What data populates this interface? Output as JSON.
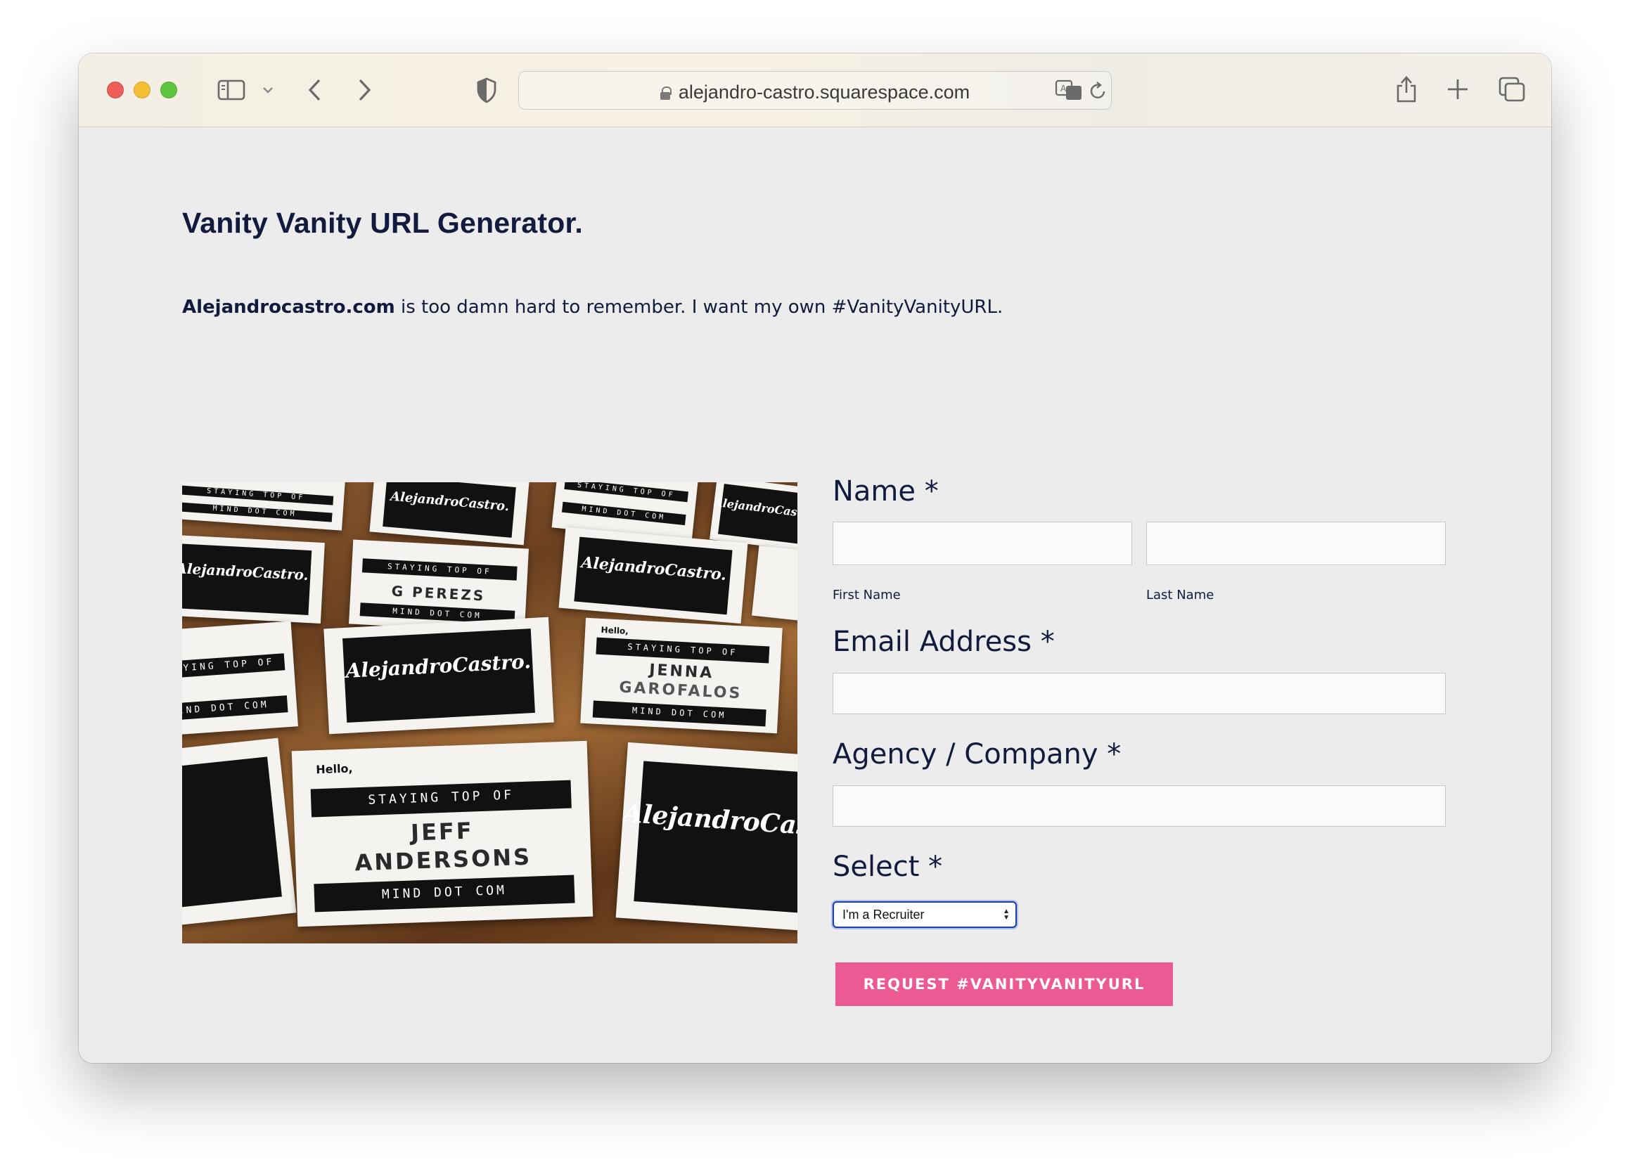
{
  "browser": {
    "url": "alejandro-castro.squarespace.com"
  },
  "page": {
    "title": "Vanity Vanity URL Generator.",
    "intro_bold": "Alejandrocastro.com",
    "intro_rest": " is too damn hard to remember. I want my own #VanityVanityURL."
  },
  "image": {
    "cards": {
      "script": "AlejandroCastro.",
      "staying": "STAYING TOP OF",
      "mind": "MIND DOT COM",
      "hello": "Hello,",
      "name_1": "G PEREZS",
      "name_2a": "JENNA",
      "name_2b": "GAROFALOS",
      "name_3a": "JEFF",
      "name_3b": "ANDERSONS"
    }
  },
  "form": {
    "name_label": "Name *",
    "first_name_label": "First Name",
    "last_name_label": "Last Name",
    "email_label": "Email Address *",
    "agency_label": "Agency / Company *",
    "select_label": "Select *",
    "select_value": "I'm a Recruiter",
    "submit_label": "REQUEST #VANITYVANITYURL"
  },
  "colors": {
    "heading": "#121a3d",
    "button": "#ec5a93",
    "background": "#ececec"
  }
}
